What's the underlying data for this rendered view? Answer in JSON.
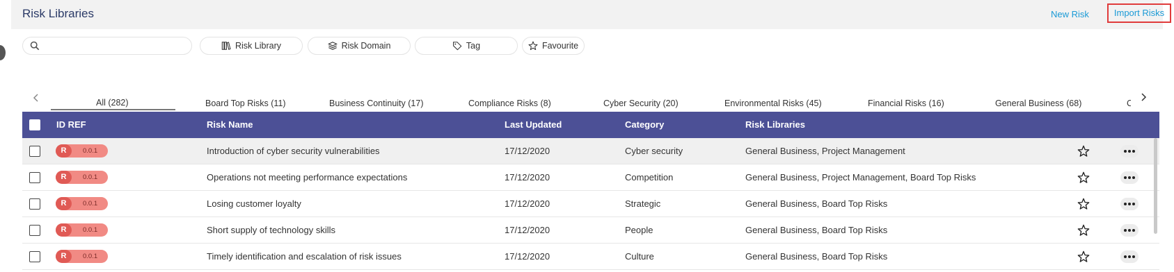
{
  "header": {
    "title": "Risk Libraries",
    "new_risk_label": "New Risk",
    "import_risks_label": "Import Risks"
  },
  "search": {
    "placeholder": "",
    "value": ""
  },
  "filters": [
    {
      "label": "Risk Library",
      "icon": "library-icon"
    },
    {
      "label": "Risk Domain",
      "icon": "layers-icon"
    },
    {
      "label": "Tag",
      "icon": "tag-icon"
    },
    {
      "label": "Favourite",
      "icon": "star-icon"
    }
  ],
  "tabs": [
    {
      "label": "All (282)",
      "active": true
    },
    {
      "label": "Board Top Risks (11)"
    },
    {
      "label": "Business Continuity (17)"
    },
    {
      "label": "Compliance Risks (8)"
    },
    {
      "label": "Cyber Security (20)"
    },
    {
      "label": "Environmental Risks (45)"
    },
    {
      "label": "Financial Risks (16)"
    },
    {
      "label": "General Business (68)"
    },
    {
      "label": "C"
    }
  ],
  "table": {
    "columns": {
      "id_ref": "ID REF",
      "risk_name": "Risk Name",
      "last_updated": "Last Updated",
      "category": "Category",
      "risk_libraries": "Risk Libraries"
    },
    "rows": [
      {
        "badge": "R",
        "version": "0.0.1",
        "name": "Introduction of cyber security vulnerabilities",
        "updated": "17/12/2020",
        "category": "Cyber security",
        "libraries": "General Business, Project Management"
      },
      {
        "badge": "R",
        "version": "0.0.1",
        "name": "Operations not meeting performance expectations",
        "updated": "17/12/2020",
        "category": "Competition",
        "libraries": "General Business, Project Management, Board Top Risks"
      },
      {
        "badge": "R",
        "version": "0.0.1",
        "name": "Losing customer loyalty",
        "updated": "17/12/2020",
        "category": "Strategic",
        "libraries": "General Business, Board Top Risks"
      },
      {
        "badge": "R",
        "version": "0.0.1",
        "name": "Short supply of technology skills",
        "updated": "17/12/2020",
        "category": "People",
        "libraries": "General Business, Board Top Risks"
      },
      {
        "badge": "R",
        "version": "0.0.1",
        "name": "Timely identification and escalation of risk issues",
        "updated": "17/12/2020",
        "category": "Culture",
        "libraries": "General Business, Board Top Risks"
      }
    ]
  },
  "colors": {
    "accent": "#4c5096",
    "link": "#1a9ad6",
    "badge": "#f18a84",
    "badge_dark": "#e05a55",
    "highlight_border": "#e03b3b"
  }
}
